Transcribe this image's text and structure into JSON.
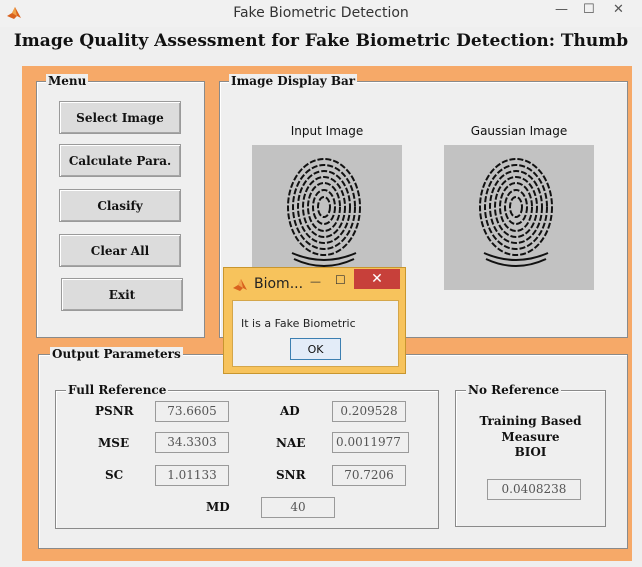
{
  "window": {
    "title": "Fake Biometric Detection",
    "minimize": "—",
    "maximize": "☐",
    "close": "✕"
  },
  "heading": "Image Quality Assessment for Fake Biometric Detection: Thumb",
  "menu": {
    "legend": "Menu",
    "buttons": [
      "Select Image",
      "Calculate Para.",
      "Clasify",
      "Clear All",
      "Exit"
    ]
  },
  "display": {
    "legend": "Image Display Bar",
    "input_title": "Input Image",
    "gaussian_title": "Gaussian Image"
  },
  "output": {
    "legend": "Output Parameters",
    "full_reference": {
      "legend": "Full Reference",
      "psnr_label": "PSNR",
      "psnr": "73.6605",
      "mse_label": "MSE",
      "mse": "34.3303",
      "sc_label": "SC",
      "sc": "1.01133",
      "ad_label": "AD",
      "ad": "0.209528",
      "nae_label": "NAE",
      "nae": "0.0011977",
      "snr_label": "SNR",
      "snr": "70.7206",
      "md_label": "MD",
      "md": "40"
    },
    "no_reference": {
      "legend": "No Reference",
      "line1": "Training Based",
      "line2": "Measure",
      "line3": "BIOI",
      "value": "0.0408238"
    }
  },
  "dialog": {
    "title": "Biom...",
    "minimize": "—",
    "maximize": "☐",
    "close": "✕",
    "message": "It is a Fake Biometric",
    "ok": "OK"
  },
  "colors": {
    "accent_orange": "#f6a968",
    "dialog_yellow": "#f7c35c",
    "close_red": "#c7403a"
  }
}
